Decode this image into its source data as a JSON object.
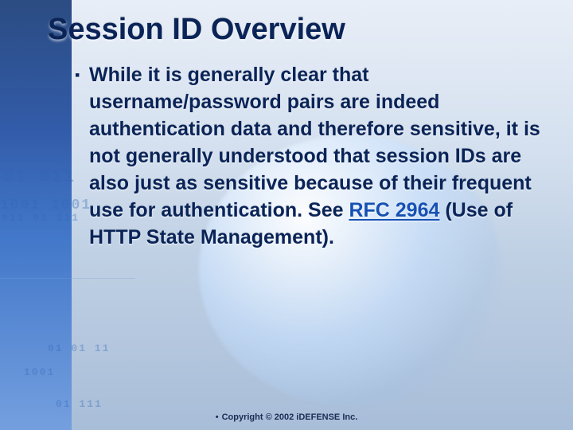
{
  "title": "Session ID Overview",
  "bullet": {
    "pre": "While it is generally clear that username/password pairs are indeed authentication data and therefore sensitive, it is not generally understood that session IDs are also just as sensitive because of their frequent use for authentication. See ",
    "link": "RFC 2964",
    "post": " (Use of HTTP State Management)."
  },
  "footer": "Copyright © 2002 iDEFENSE Inc.",
  "decor": {
    "ticks": [
      "01 011",
      "1001 1001",
      "011 01 111",
      "01 01 11",
      "1001",
      "01 111"
    ]
  }
}
